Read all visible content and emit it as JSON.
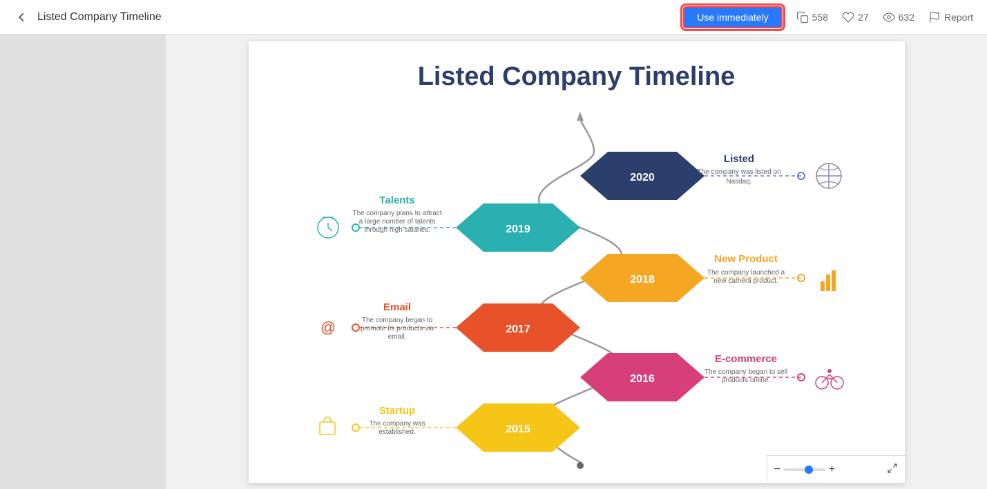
{
  "header": {
    "back_label": "‹",
    "title": "Listed Company Timeline",
    "use_immediately_label": "Use immediately",
    "stats": {
      "copies": "558",
      "likes": "27",
      "views": "632",
      "report": "Report"
    }
  },
  "slide": {
    "title": "Listed Company Timeline",
    "events": [
      {
        "year": "2020",
        "name": "Listed",
        "desc": "The company was listed on\nNasdaq.",
        "color": "#2c3e6b",
        "side": "right"
      },
      {
        "year": "2019",
        "name": "Talents",
        "desc": "The company plans to attract\na large number of talents\nthrough high salaries.",
        "color": "#2ab0b0",
        "side": "left"
      },
      {
        "year": "2018",
        "name": "New Product",
        "desc": "The company launched a\nnew camera product.",
        "color": "#f5a623",
        "side": "right"
      },
      {
        "year": "2017",
        "name": "Email",
        "desc": "The company began to\npromote its products via\nemail.",
        "color": "#e8522a",
        "side": "left"
      },
      {
        "year": "2016",
        "name": "E-commerce",
        "desc": "The company began to sell\nproducts online.",
        "color": "#d63f7a",
        "side": "right"
      },
      {
        "year": "2015",
        "name": "Startup",
        "desc": "The company was\nestablished.",
        "color": "#f5c518",
        "side": "left"
      }
    ]
  },
  "zoom": {
    "minus": "−",
    "plus": "+",
    "level": "50"
  }
}
